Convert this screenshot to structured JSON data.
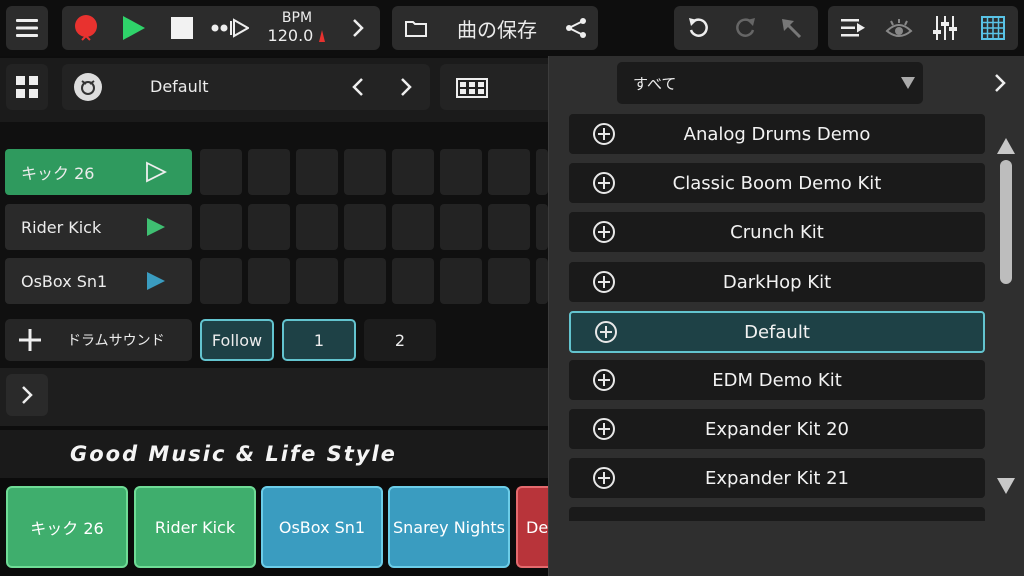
{
  "transport": {
    "bpm_label": "BPM",
    "bpm_value": "120.0"
  },
  "song": {
    "save_label": "曲の保存"
  },
  "kit": {
    "name": "Default"
  },
  "tracks": [
    {
      "label": "キック 26"
    },
    {
      "label": "Rider Kick"
    },
    {
      "label": "OsBox Sn1"
    }
  ],
  "controls": {
    "add_drum_sound": "ドラムサウンド",
    "follow": "Follow",
    "page_1": "1",
    "page_2": "2"
  },
  "banner": {
    "text": "Good Music & Life Style"
  },
  "pads": [
    {
      "label": "キック 26"
    },
    {
      "label": "Rider Kick"
    },
    {
      "label": "OsBox Sn1"
    },
    {
      "label": "Snarey Nights"
    },
    {
      "label": "De"
    }
  ],
  "browser": {
    "filter_value": "すべて",
    "items": [
      {
        "label": "Analog Drums Demo"
      },
      {
        "label": "Classic Boom Demo Kit"
      },
      {
        "label": "Crunch Kit"
      },
      {
        "label": "DarkHop Kit"
      },
      {
        "label": "Default"
      },
      {
        "label": "EDM Demo Kit"
      },
      {
        "label": "Expander Kit 20"
      },
      {
        "label": "Expander Kit 21"
      }
    ]
  },
  "colors": {
    "accent_green": "#2f9a5e",
    "accent_teal": "#63c4cf",
    "record_red": "#e8322f",
    "play_green": "#2fd36a",
    "grid_icon": "#59c3e6"
  }
}
